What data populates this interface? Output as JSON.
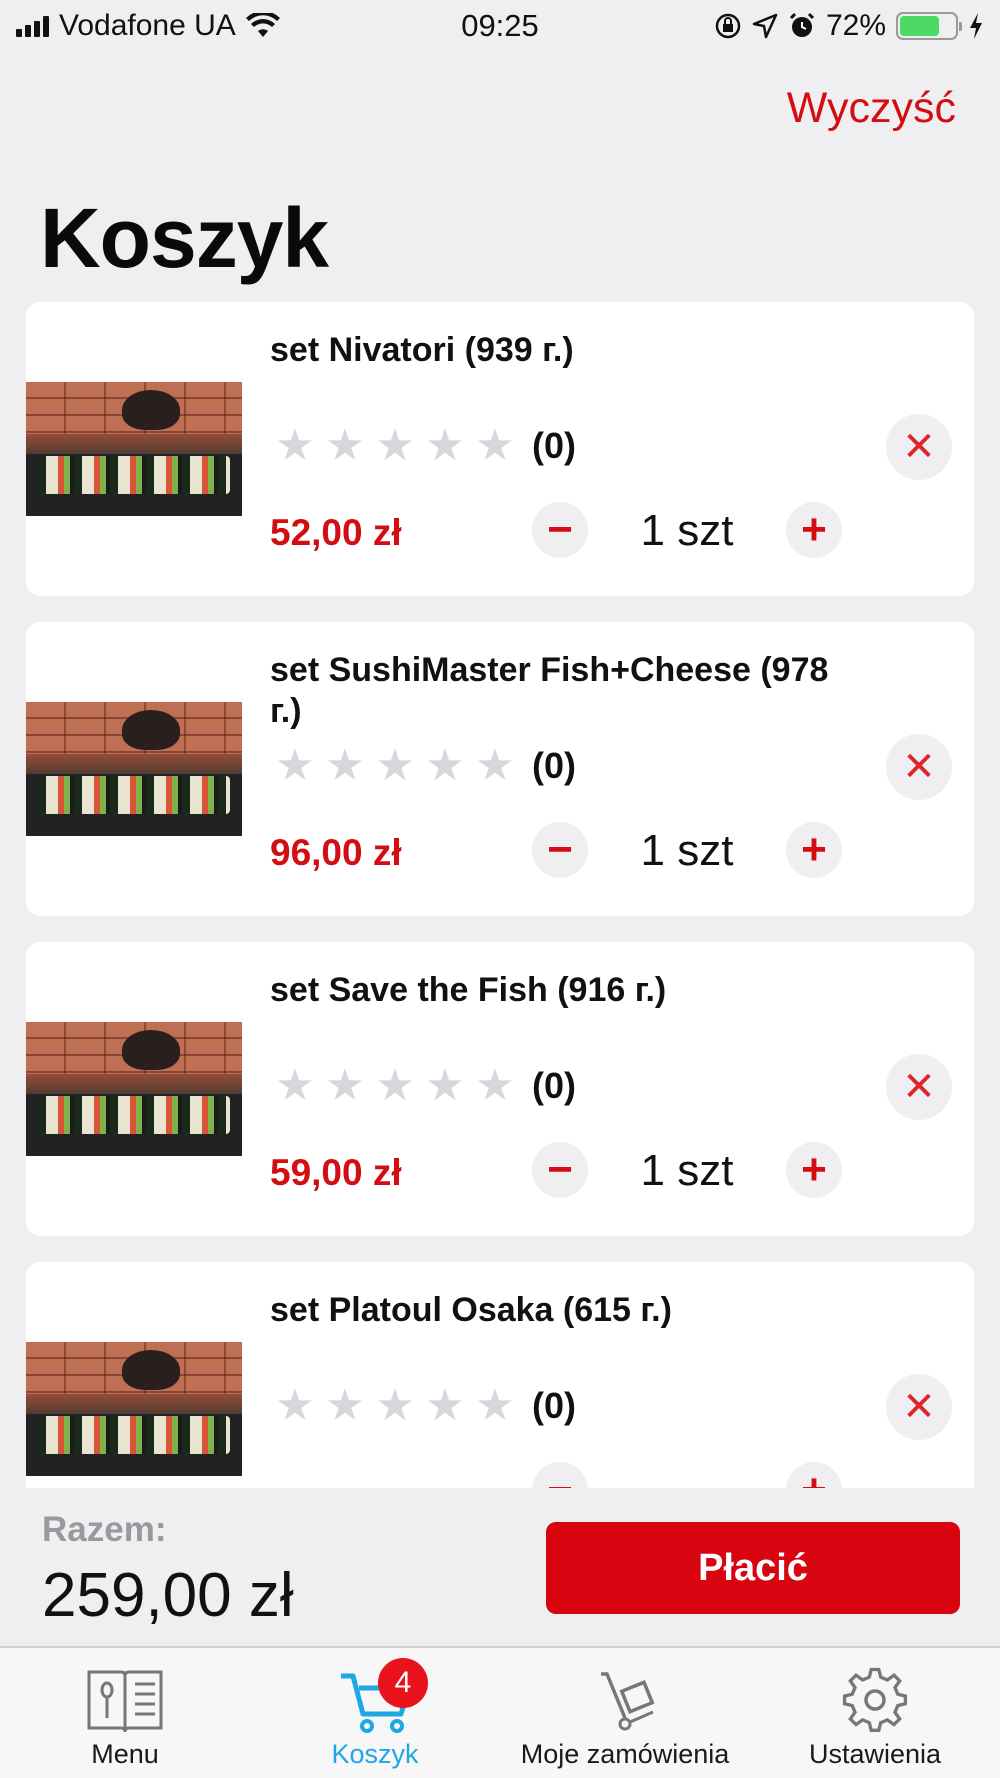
{
  "status_bar": {
    "carrier": "Vodafone UA",
    "time": "09:25",
    "battery_percent": "72%",
    "battery_level": 0.72,
    "icons": [
      "signal-icon",
      "wifi-icon",
      "rotation-lock-icon",
      "location-icon",
      "alarm-icon",
      "battery-icon",
      "charging-icon"
    ]
  },
  "header": {
    "clear_label": "Wyczyść",
    "title": "Koszyk"
  },
  "cart": {
    "items": [
      {
        "name": "set  Nivatori  (939 г.)",
        "rating_count": "(0)",
        "rating_value": 0,
        "price": "52,00 zł",
        "quantity": "1 szt"
      },
      {
        "name": "set SushiMaster Fish+Cheese (978 г.)",
        "rating_count": "(0)",
        "rating_value": 0,
        "price": "96,00 zł",
        "quantity": "1 szt"
      },
      {
        "name": "set Save the Fish (916 г.)",
        "rating_count": "(0)",
        "rating_value": 0,
        "price": "59,00 zł",
        "quantity": "1 szt"
      },
      {
        "name": "set Platoul Osaka (615 г.)",
        "rating_count": "(0)",
        "rating_value": 0,
        "price": "",
        "quantity": ""
      }
    ],
    "minus_symbol": "−",
    "plus_symbol": "+",
    "remove_symbol": "✕",
    "star_symbol": "★"
  },
  "footer": {
    "total_label": "Razem:",
    "total_value": "259,00 zł",
    "pay_label": "Płacić"
  },
  "tabs": [
    {
      "label": "Menu",
      "icon": "menu-book-icon",
      "active": false
    },
    {
      "label": "Koszyk",
      "icon": "cart-icon",
      "active": true,
      "badge": "4"
    },
    {
      "label": "Moje zamówienia",
      "icon": "dolly-icon",
      "active": false
    },
    {
      "label": "Ustawienia",
      "icon": "gear-icon",
      "active": false
    }
  ],
  "colors": {
    "accent_red": "#d40d12",
    "active_tab_blue": "#1ea7e6",
    "background": "#efeff1",
    "battery_green": "#4cd964"
  }
}
